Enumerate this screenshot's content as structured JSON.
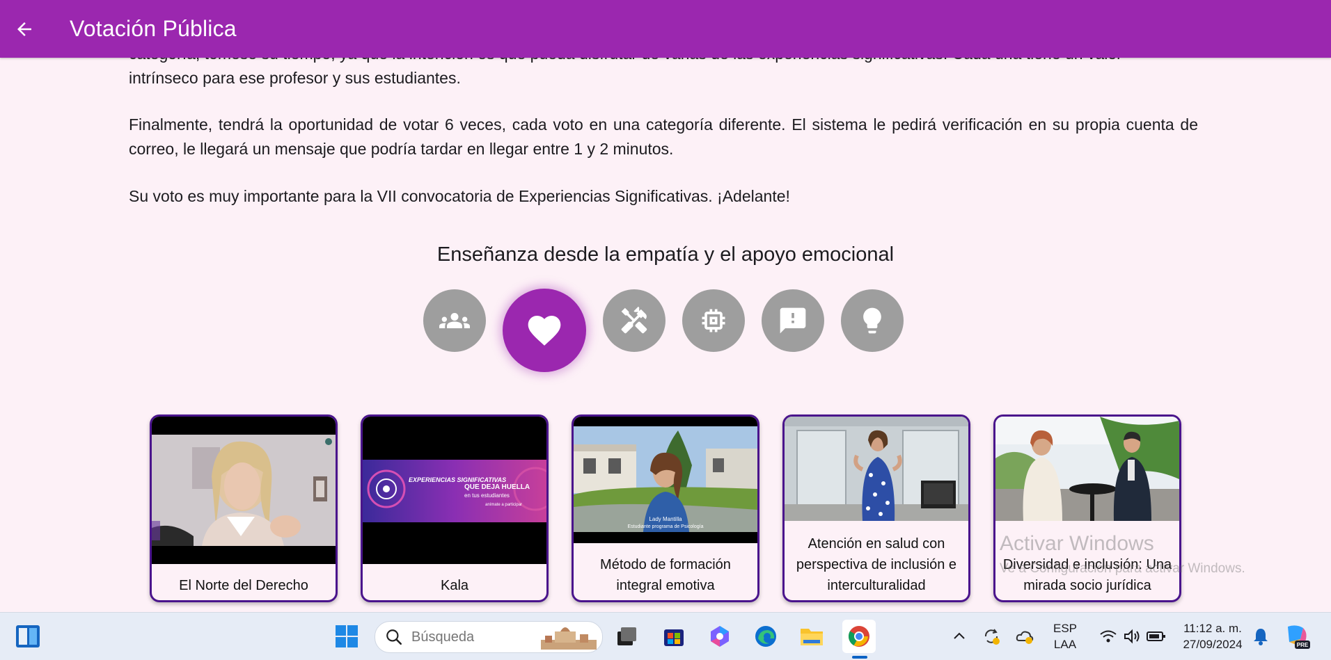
{
  "app_bar": {
    "title": "Votación Pública",
    "back_icon": "arrow-back-icon"
  },
  "intro": {
    "partial_line": "categoría, tomese su tiempo, ya que la intención es que pueda disfrutar de varias de las experiencias significativas. Cada una tiene un valor",
    "line_tail": "intrínseco para ese profesor y sus estudiantes.",
    "paragraph_2": "Finalmente, tendrá la oportunidad de votar 6 veces, cada voto en una categoría diferente. El sistema le pedirá verificación en su propia cuenta de correo, le llegará un mensaje que podría tardar en llegar entre 1 y 2 minutos.",
    "paragraph_3": "Su voto es muy importante para la VII convocatoria de Experiencias Significativas. ¡Adelante!"
  },
  "category": {
    "title": "Enseñanza desde la empatía y el apoyo emocional",
    "buttons": [
      {
        "icon": "groups-icon",
        "active": false
      },
      {
        "icon": "heart-icon",
        "active": true
      },
      {
        "icon": "tools-icon",
        "active": false
      },
      {
        "icon": "chip-icon",
        "active": false
      },
      {
        "icon": "feedback-icon",
        "active": false
      },
      {
        "icon": "lightbulb-icon",
        "active": false
      }
    ],
    "active_color": "#9b27af",
    "inactive_color": "#9e9e9e"
  },
  "cards": [
    {
      "label": "El Norte del Derecho"
    },
    {
      "label": "Kala",
      "thumb_text": {
        "brand": "EXPERIENCIAS SIGNIFICATIVAS",
        "tagline": "QUE DEJA HUELLA",
        "sub": "en tus estudiantes",
        "cta": "anímate a participar"
      }
    },
    {
      "label": "Método de formación integral emotiva",
      "thumb_caption": {
        "name": "Lady Mantilla",
        "role": "Estudiante programa de Psicología"
      }
    },
    {
      "label": "Atención en salud con perspectiva de inclusión e interculturalidad"
    },
    {
      "label": "Diversidad e inclusión: Una mirada socio jurídica"
    }
  ],
  "watermark": {
    "line1": "Activar Windows",
    "line2": "Ve a Configuración para activar Windows."
  },
  "taskbar": {
    "search_placeholder": "Búsqueda",
    "language": "ESP",
    "layout": "LAA",
    "time": "11:12 a. m.",
    "date": "27/09/2024",
    "copilot_badge": "PRE"
  }
}
